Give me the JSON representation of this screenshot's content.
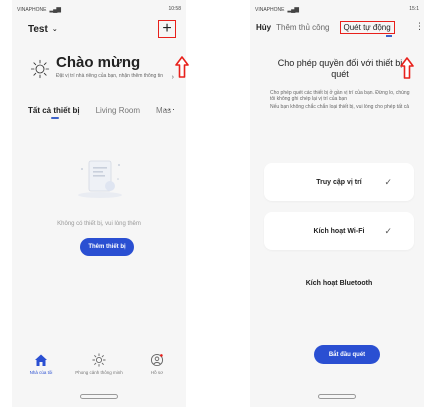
{
  "colors": {
    "accent": "#2a4fd2",
    "highlight_red": "#e8201b",
    "phone_bg": "#f6f6f6"
  },
  "left_phone": {
    "status_bar": {
      "carrier": "VINAPHONE",
      "time": "10:58"
    },
    "header": {
      "home_name": "Test",
      "chevron": "⌄",
      "add_icon": "plus-icon"
    },
    "welcome": {
      "title": "Chào mừng",
      "subtitle": "Đặt vị trí nhà riêng của bạn, nhận thêm thông tin"
    },
    "tabs": [
      "Tất cả thiết bị",
      "Living Room",
      "Mas"
    ],
    "more": "···",
    "empty_state": {
      "text": "Không có thiết bị, vui lòng thêm",
      "button": "Thêm thiết bị"
    },
    "bottom_nav": [
      {
        "label": "Nhà của tôi",
        "icon": "home-icon",
        "active": true
      },
      {
        "label": "Phong cảnh thông minh",
        "icon": "sun-icon",
        "active": false
      },
      {
        "label": "Hồ sơ",
        "icon": "profile-icon",
        "active": false
      }
    ]
  },
  "right_phone": {
    "status_bar": {
      "carrier": "VINAPHONE",
      "time": "15:1"
    },
    "header": {
      "cancel": "Hủy",
      "manual_tab": "Thêm thủ công",
      "auto_tab": "Quét tự động"
    },
    "title": "Cho phép quyền đối với thiết bị quét",
    "desc_1": "Cho phép quét các thiết bị ở gần vị trí của bạn. Đừng lo, chúng tôi không ghi chép lại vị trí của bạn",
    "desc_2": "Nếu bạn không chắc chắn loại thiết bị, vui lòng cho phép tất cả",
    "permissions": [
      {
        "label": "Truy cập vị trí",
        "enabled": true
      },
      {
        "label": "Kích hoạt Wi-Fi",
        "enabled": true
      },
      {
        "label": "Kích hoạt Bluetooth",
        "enabled": false
      }
    ],
    "check_mark": "✓",
    "start_button": "Bắt đầu quét"
  }
}
